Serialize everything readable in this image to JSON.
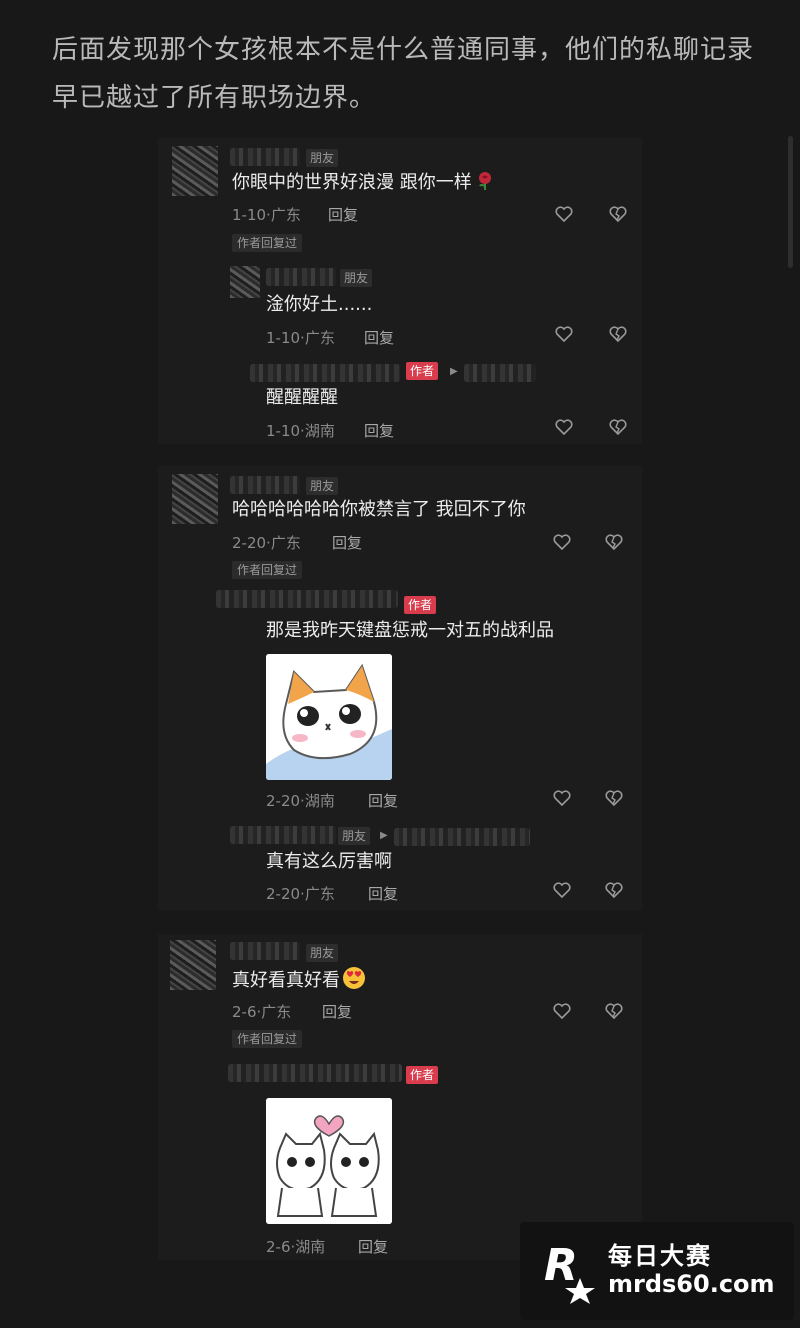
{
  "intro_text": "后面发现那个女孩根本不是什么普通同事，他们的私聊记录早已越过了所有职场边界。",
  "labels": {
    "friend": "朋友",
    "author": "作者",
    "author_replied": "作者回复过",
    "reply": "回复"
  },
  "threads": [
    {
      "comment": {
        "text": "你眼中的世界好浪漫  跟你一样",
        "date": "1-10",
        "location": "广东"
      },
      "replies": [
        {
          "text": "淦你好土......",
          "date": "1-10",
          "location": "广东"
        },
        {
          "text": "醒醒醒醒",
          "date": "1-10",
          "location": "湖南"
        }
      ]
    },
    {
      "comment": {
        "text": "哈哈哈哈哈哈你被禁言了 我回不了你",
        "date": "2-20",
        "location": "广东"
      },
      "replies": [
        {
          "text": "那是我昨天键盘惩戒一对五的战利品",
          "date": "2-20",
          "location": "湖南"
        },
        {
          "text": "真有这么厉害啊",
          "date": "2-20",
          "location": "广东"
        }
      ]
    },
    {
      "comment": {
        "text": "真好看真好看",
        "date": "2-6",
        "location": "广东"
      },
      "replies": [
        {
          "text": "",
          "date": "2-6",
          "location": "湖南"
        }
      ]
    }
  ],
  "watermark": {
    "title": "每日大赛",
    "url": "mrds60.com"
  },
  "colors": {
    "background": "#181818",
    "author_badge": "#d83c4d",
    "text": "#ececec",
    "meta": "#8a8a8a"
  }
}
